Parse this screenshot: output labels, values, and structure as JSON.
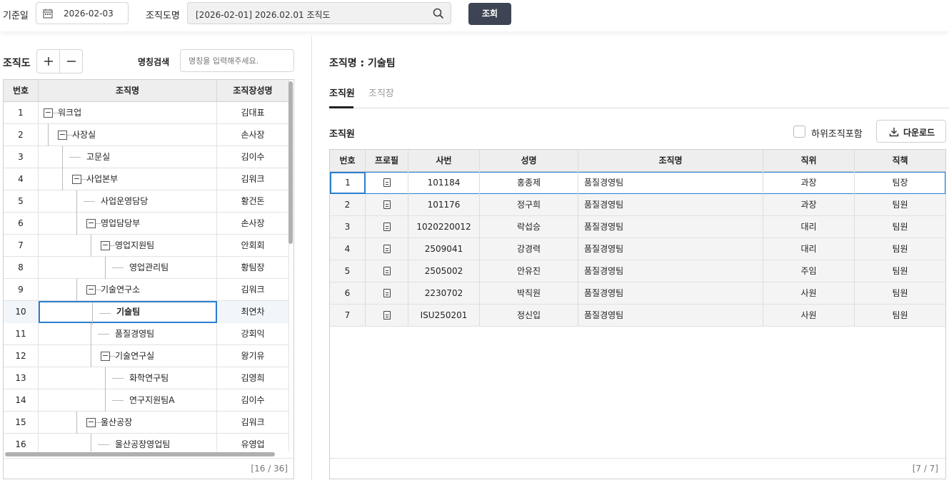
{
  "filters": {
    "base_date_label": "기준일",
    "base_date_value": "2026-02-03",
    "org_chart_label": "조직도명",
    "org_chart_value": "[2026-02-01] 2026.02.01 조직도",
    "query_button": "조회"
  },
  "left": {
    "title": "조직도",
    "name_search_label": "명칭검색",
    "name_search_placeholder": "명칭을 입력해주세요.",
    "columns": [
      "번호",
      "조직명",
      "조직장성명"
    ],
    "rows": [
      {
        "no": "1",
        "name": "워크업",
        "head": "김대표"
      },
      {
        "no": "2",
        "name": "사장실",
        "head": "손사장"
      },
      {
        "no": "3",
        "name": "고문실",
        "head": "김이수"
      },
      {
        "no": "4",
        "name": "사업본부",
        "head": "김워크"
      },
      {
        "no": "5",
        "name": "사업운영담당",
        "head": "황건돈"
      },
      {
        "no": "6",
        "name": "영업담당부",
        "head": "손사장"
      },
      {
        "no": "7",
        "name": "영업지원팀",
        "head": "안회회"
      },
      {
        "no": "8",
        "name": "영업관리팀",
        "head": "황팀장"
      },
      {
        "no": "9",
        "name": "기술연구소",
        "head": "김워크"
      },
      {
        "no": "10",
        "name": "기술팀",
        "head": "최연차"
      },
      {
        "no": "11",
        "name": "품질경영팀",
        "head": "강회익"
      },
      {
        "no": "12",
        "name": "기술연구실",
        "head": "왕기유"
      },
      {
        "no": "13",
        "name": "화학연구팀",
        "head": "김영희"
      },
      {
        "no": "14",
        "name": "연구지원팀A",
        "head": "김이수"
      },
      {
        "no": "15",
        "name": "울산공장",
        "head": "김워크"
      },
      {
        "no": "16",
        "name": "울산공장영업팀",
        "head": "유영업"
      }
    ],
    "footer": "[16 / 36]"
  },
  "right": {
    "org_title": "조직명 : 기술팀",
    "tabs": [
      "조직원",
      "조직장"
    ],
    "section_title": "조직원",
    "include_sub_label": "하위조직포함",
    "download_label": "다운로드",
    "columns": [
      "번호",
      "프로필",
      "사번",
      "성명",
      "조직명",
      "직위",
      "직책"
    ],
    "rows": [
      {
        "no": "1",
        "emp": "101184",
        "name": "홍종제",
        "org": "품질경영팀",
        "pos": "과장",
        "role": "팀장"
      },
      {
        "no": "2",
        "emp": "101176",
        "name": "정구희",
        "org": "품질경영팀",
        "pos": "과장",
        "role": "팀원"
      },
      {
        "no": "3",
        "emp": "1020220012",
        "name": "락섭승",
        "org": "품질경영팀",
        "pos": "대리",
        "role": "팀원"
      },
      {
        "no": "4",
        "emp": "2509041",
        "name": "강경력",
        "org": "품질경영팀",
        "pos": "대리",
        "role": "팀원"
      },
      {
        "no": "5",
        "emp": "2505002",
        "name": "안유진",
        "org": "품질경영팀",
        "pos": "주임",
        "role": "팀원"
      },
      {
        "no": "6",
        "emp": "2230702",
        "name": "박직원",
        "org": "품질경영팀",
        "pos": "사원",
        "role": "팀원"
      },
      {
        "no": "7",
        "emp": "ISU250201",
        "name": "정신입",
        "org": "품질경영팀",
        "pos": "사원",
        "role": "팀원"
      }
    ],
    "footer": "[7 / 7]"
  },
  "colors": {
    "accent": "#2a7fd0",
    "button_dark": "#3d4554"
  }
}
